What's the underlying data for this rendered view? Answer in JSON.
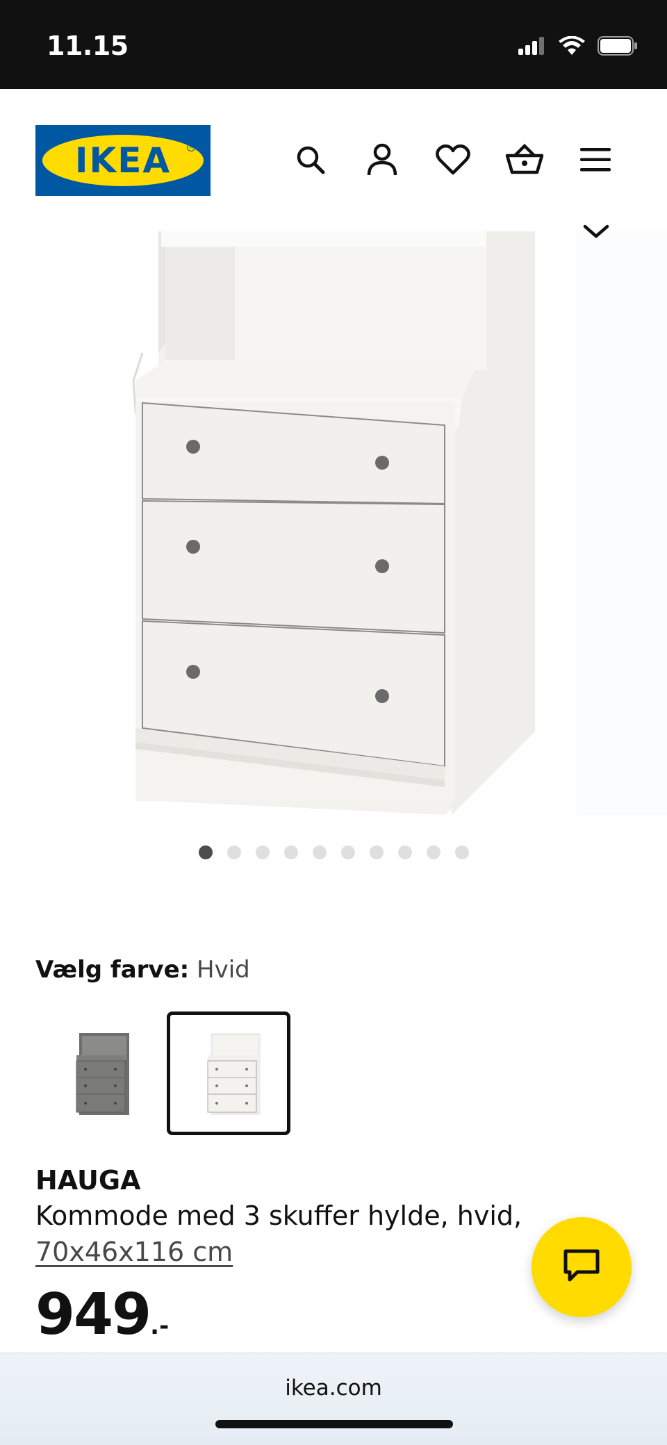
{
  "status_bar": {
    "time": "11.15",
    "icons": [
      "cellular-signal-icon",
      "wifi-icon",
      "battery-icon"
    ]
  },
  "header": {
    "logo_text": "IKEA",
    "logo_colors": {
      "background": "#0058a3",
      "oval": "#ffdb00"
    },
    "nav_icons": [
      "search-icon",
      "account-icon",
      "heart-icon",
      "basket-icon",
      "menu-icon"
    ]
  },
  "gallery": {
    "image_count": 10,
    "active_index": 0
  },
  "color_selector": {
    "label": "Vælg farve:",
    "selected_value": "Hvid",
    "options": [
      {
        "swatch": "grey",
        "selected": false
      },
      {
        "swatch": "white",
        "selected": true
      }
    ]
  },
  "product": {
    "name": "HAUGA",
    "description": "Kommode med 3 skuffer hylde, hvid,",
    "size": "70x46x116 cm",
    "price": "949",
    "price_suffix": ".-"
  },
  "chat": {
    "icon": "chat-bubble-icon",
    "color": "#ffdb00"
  },
  "browser": {
    "url": "ikea.com"
  }
}
